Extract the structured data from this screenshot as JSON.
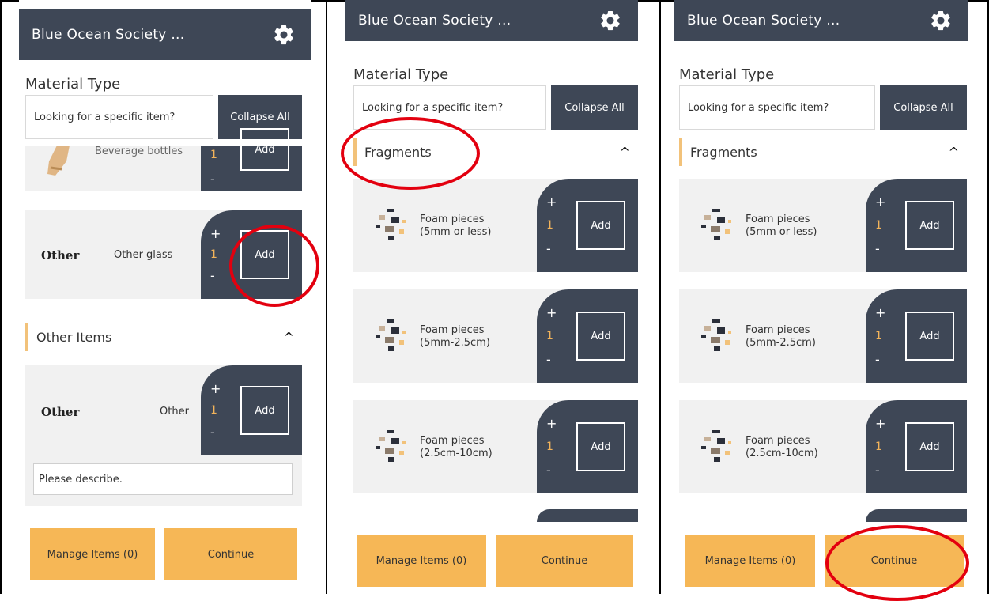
{
  "header": {
    "title": "Blue Ocean Society ..."
  },
  "material_type_label": "Material Type",
  "search": {
    "placeholder": "Looking for a specific item?"
  },
  "collapse_all_label": "Collapse All",
  "panel1": {
    "partial_item": {
      "name": "Beverage bottles",
      "qty": "1",
      "add": "Add"
    },
    "other_glass": {
      "category": "Other",
      "name": "Other glass",
      "plus": "+",
      "qty": "1",
      "minus": "-",
      "add": "Add"
    },
    "group_other_items": "Other Items",
    "other_item": {
      "category": "Other",
      "name": "Other",
      "plus": "+",
      "qty": "1",
      "minus": "-",
      "add": "Add"
    },
    "describe_placeholder": "Please describe."
  },
  "fragments": {
    "group": "Fragments",
    "items": [
      {
        "name_line1": "Foam pieces",
        "name_line2": "(5mm or less)",
        "plus": "+",
        "qty": "1",
        "minus": "-",
        "add": "Add"
      },
      {
        "name_line1": "Foam pieces",
        "name_line2": "(5mm-2.5cm)",
        "plus": "+",
        "qty": "1",
        "minus": "-",
        "add": "Add"
      },
      {
        "name_line1": "Foam pieces",
        "name_line2": "(2.5cm-10cm)",
        "plus": "+",
        "qty": "1",
        "minus": "-",
        "add": "Add"
      }
    ]
  },
  "footer": {
    "manage_label": "Manage Items (0)",
    "continue_label": "Continue"
  },
  "colors": {
    "header": "#3e4756",
    "accent": "#f6b756",
    "highlight": "#e3000f"
  }
}
